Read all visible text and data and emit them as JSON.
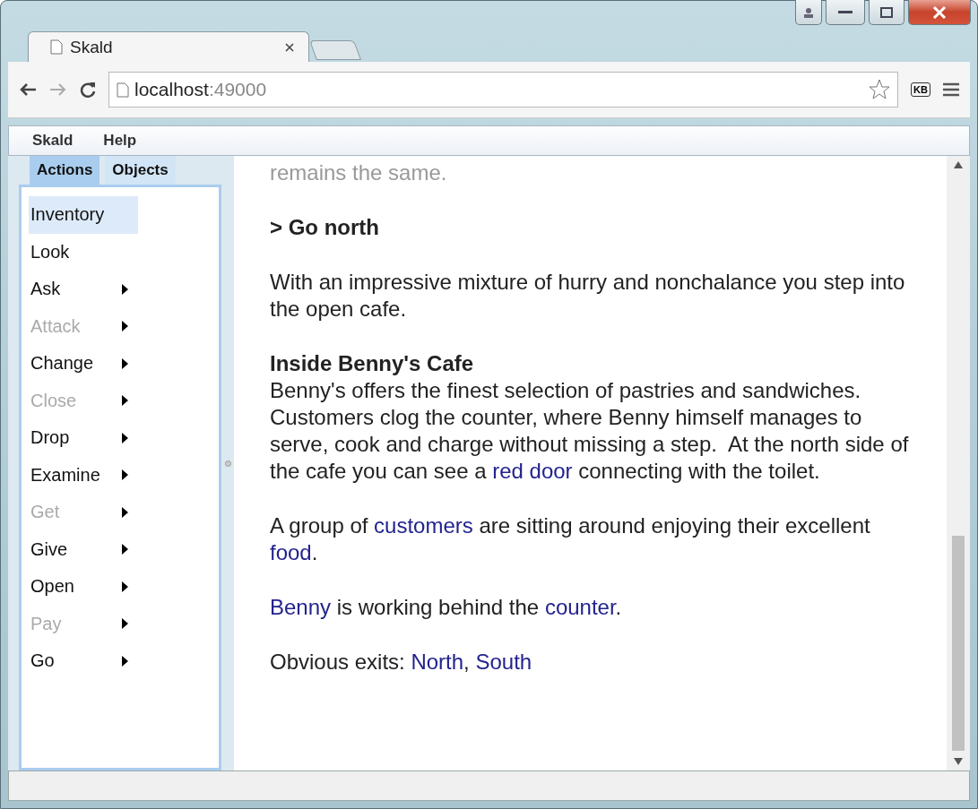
{
  "browser": {
    "tab_title": "Skald",
    "url_host": "localhost",
    "url_port": ":49000",
    "kb_badge": "KB"
  },
  "menu": [
    "Skald",
    "Help"
  ],
  "panel_tabs": [
    {
      "label": "Actions",
      "selected": true
    },
    {
      "label": "Objects",
      "selected": false
    }
  ],
  "actions": [
    {
      "label": "Inventory",
      "selected": true,
      "disabled": false,
      "submenu": false
    },
    {
      "label": "Look",
      "selected": false,
      "disabled": false,
      "submenu": false
    },
    {
      "label": "Ask",
      "selected": false,
      "disabled": false,
      "submenu": true
    },
    {
      "label": "Attack",
      "selected": false,
      "disabled": true,
      "submenu": true
    },
    {
      "label": "Change",
      "selected": false,
      "disabled": false,
      "submenu": true
    },
    {
      "label": "Close",
      "selected": false,
      "disabled": true,
      "submenu": true
    },
    {
      "label": "Drop",
      "selected": false,
      "disabled": false,
      "submenu": true
    },
    {
      "label": "Examine",
      "selected": false,
      "disabled": false,
      "submenu": true
    },
    {
      "label": "Get",
      "selected": false,
      "disabled": true,
      "submenu": true
    },
    {
      "label": "Give",
      "selected": false,
      "disabled": false,
      "submenu": true
    },
    {
      "label": "Open",
      "selected": false,
      "disabled": false,
      "submenu": true
    },
    {
      "label": "Pay",
      "selected": false,
      "disabled": true,
      "submenu": true
    },
    {
      "label": "Go",
      "selected": false,
      "disabled": false,
      "submenu": true
    }
  ],
  "story": [
    {
      "kind": "faded",
      "parts": [
        {
          "text": "remains the same.",
          "link": false
        }
      ]
    },
    {
      "kind": "command",
      "parts": [
        {
          "text": "> Go north",
          "link": false
        }
      ]
    },
    {
      "kind": "text",
      "parts": [
        {
          "text": "With an impressive mixture of hurry and nonchalance you step into the open cafe.",
          "link": false
        }
      ]
    },
    {
      "kind": "heading",
      "parts": [
        {
          "text": "Inside Benny's Cafe",
          "link": false
        }
      ]
    },
    {
      "kind": "body",
      "parts": [
        {
          "text": "Benny's offers the finest selection of pastries and sandwiches.  Customers clog the counter, where Benny himself manages to serve, cook and charge without missing a step.  At the north side of the cafe you can see a ",
          "link": false
        },
        {
          "text": "red door",
          "link": true
        },
        {
          "text": " connecting with the toilet.",
          "link": false
        }
      ]
    },
    {
      "kind": "text",
      "parts": [
        {
          "text": "A group of ",
          "link": false
        },
        {
          "text": "customers",
          "link": true
        },
        {
          "text": " are sitting around enjoying their excellent ",
          "link": false
        },
        {
          "text": "food",
          "link": true
        },
        {
          "text": ".",
          "link": false
        }
      ]
    },
    {
      "kind": "text",
      "parts": [
        {
          "text": "Benny",
          "link": true
        },
        {
          "text": " is working behind the ",
          "link": false
        },
        {
          "text": "counter",
          "link": true
        },
        {
          "text": ".",
          "link": false
        }
      ]
    },
    {
      "kind": "text",
      "parts": [
        {
          "text": "Obvious exits: ",
          "link": false
        },
        {
          "text": "North",
          "link": true
        },
        {
          "text": ", ",
          "link": false
        },
        {
          "text": "South",
          "link": true
        }
      ]
    }
  ]
}
